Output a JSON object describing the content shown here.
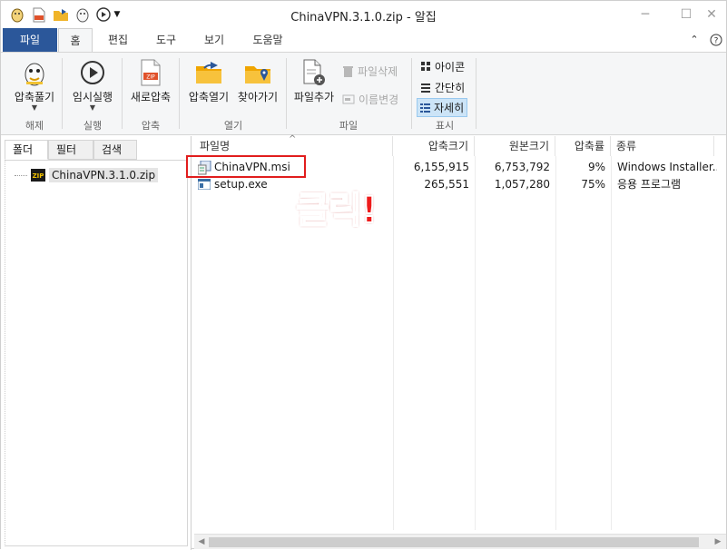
{
  "window": {
    "title": "ChinaVPN.3.1.0.zip - 알집"
  },
  "tabs": [
    {
      "label": "파일"
    },
    {
      "label": "홈"
    },
    {
      "label": "편집"
    },
    {
      "label": "도구"
    },
    {
      "label": "보기"
    },
    {
      "label": "도움말"
    }
  ],
  "ribbon": {
    "groups": [
      {
        "label": "해제"
      },
      {
        "label": "실행"
      },
      {
        "label": "압축"
      },
      {
        "label": "열기"
      },
      {
        "label": "파일"
      },
      {
        "label": "표시"
      }
    ],
    "buttons": {
      "extract": "압축풀기",
      "run": "임시실행",
      "new_archive": "새로압축",
      "open_archive": "압축열기",
      "browse": "찾아가기",
      "add_file": "파일추가",
      "delete_file": "파일삭제",
      "rename": "이름변경",
      "view_icon": "아이콘",
      "view_simple": "간단히",
      "view_detail": "자세히"
    }
  },
  "left_pane": {
    "tabs": [
      {
        "label": "폴더"
      },
      {
        "label": "필터"
      },
      {
        "label": "검색"
      }
    ],
    "tree_root": "ChinaVPN.3.1.0.zip"
  },
  "file_list": {
    "columns": [
      "파일명",
      "압축크기",
      "원본크기",
      "압축률",
      "종류"
    ],
    "rows": [
      {
        "name": "ChinaVPN.msi",
        "packed": "6,155,915",
        "original": "6,753,792",
        "ratio": "9%",
        "type": "Windows Installer..."
      },
      {
        "name": "setup.exe",
        "packed": "265,551",
        "original": "1,057,280",
        "ratio": "75%",
        "type": "응용 프로그램"
      }
    ]
  },
  "annotation": {
    "text": "클릭!",
    "color": "#e11d1d"
  },
  "colors": {
    "file_tab": "#2b579a",
    "ribbon_bg": "#f5f6f7",
    "selected_view": "#cce4f7"
  }
}
